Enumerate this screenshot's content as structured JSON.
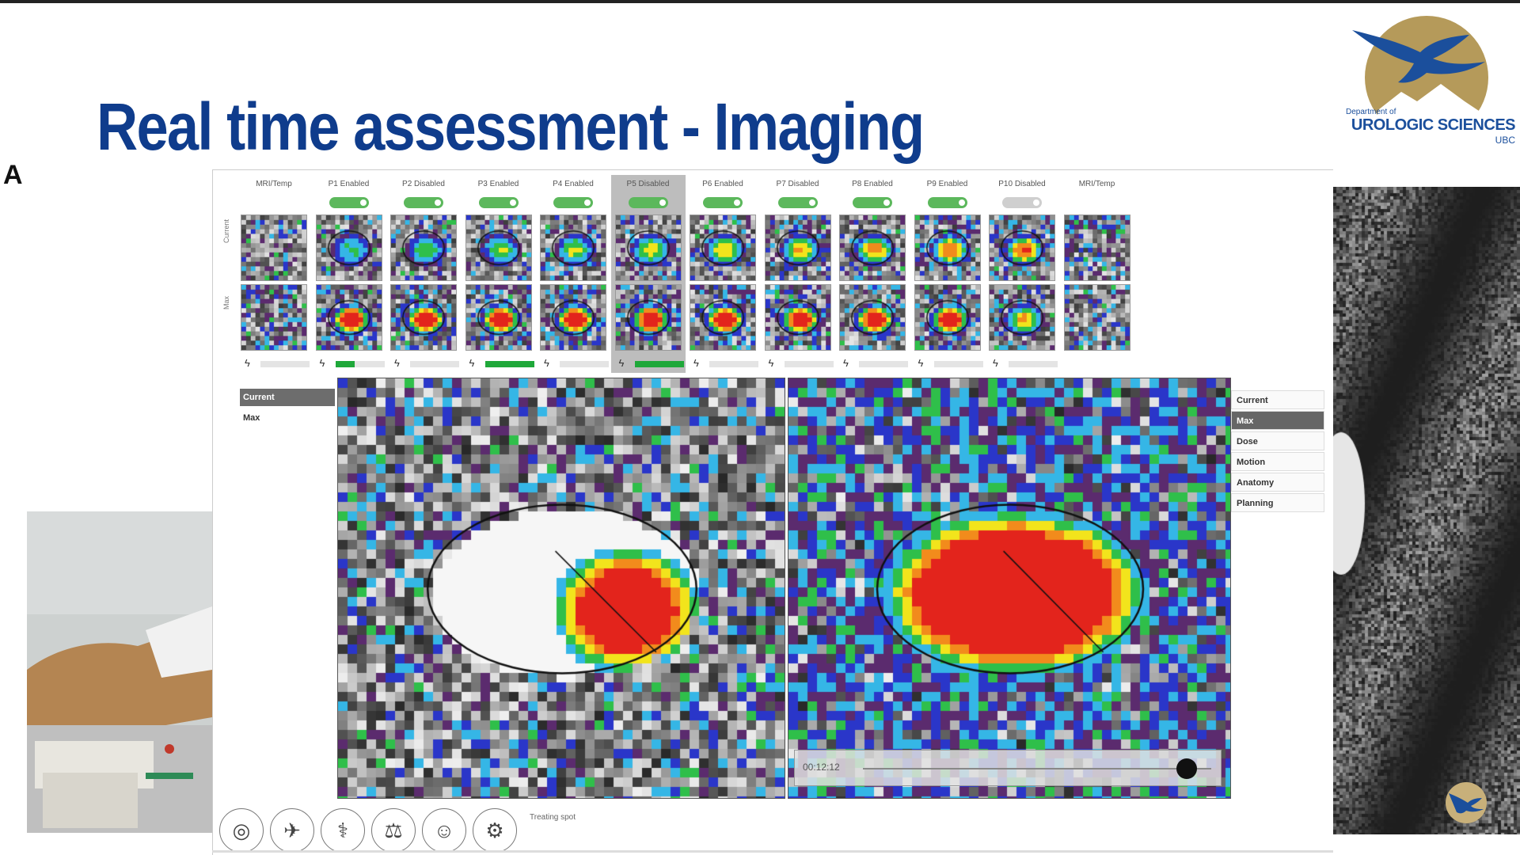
{
  "slide": {
    "title": "Real time assessment - Imaging",
    "figure_letter": "A"
  },
  "logo": {
    "dept": "Department of",
    "name": "UROLOGIC SCIENCES",
    "ubc": "UBC"
  },
  "app": {
    "side_labels": [
      "Current",
      "Max"
    ],
    "thumbnails": [
      {
        "label": "MRI/Temp",
        "toggle": "none",
        "progress": 0
      },
      {
        "label": "P1 Enabled",
        "toggle": "on",
        "progress": 0.4
      },
      {
        "label": "P2 Disabled",
        "toggle": "on",
        "progress": 0
      },
      {
        "label": "P3 Enabled",
        "toggle": "on",
        "progress": 1.0
      },
      {
        "label": "P4 Enabled",
        "toggle": "on",
        "progress": 0
      },
      {
        "label": "P5 Disabled",
        "toggle": "on",
        "progress": 1.0,
        "active": true
      },
      {
        "label": "P6 Enabled",
        "toggle": "on",
        "progress": 0
      },
      {
        "label": "P7 Disabled",
        "toggle": "on",
        "progress": 0
      },
      {
        "label": "P8 Enabled",
        "toggle": "on",
        "progress": 0
      },
      {
        "label": "P9 Enabled",
        "toggle": "on",
        "progress": 0
      },
      {
        "label": "P10 Disabled",
        "toggle": "off",
        "progress": 0
      },
      {
        "label": "MRI/Temp",
        "toggle": "none",
        "progress": 0
      }
    ],
    "modes": [
      {
        "label": "Current",
        "selected": true
      },
      {
        "label": "Max",
        "selected": false
      }
    ],
    "options": [
      {
        "label": "Current",
        "selected": false
      },
      {
        "label": "Max",
        "selected": true
      },
      {
        "label": "Dose",
        "selected": false
      },
      {
        "label": "Motion",
        "selected": false
      },
      {
        "label": "Anatomy",
        "selected": false
      },
      {
        "label": "Planning",
        "selected": false
      }
    ],
    "time_slider": {
      "text": "00:12:12",
      "value": 0.93
    },
    "tools": [
      "scanner-icon",
      "patient-icon",
      "probe-icon",
      "table-icon",
      "body-icon",
      "gear-icon"
    ],
    "status": "Treating spot"
  }
}
